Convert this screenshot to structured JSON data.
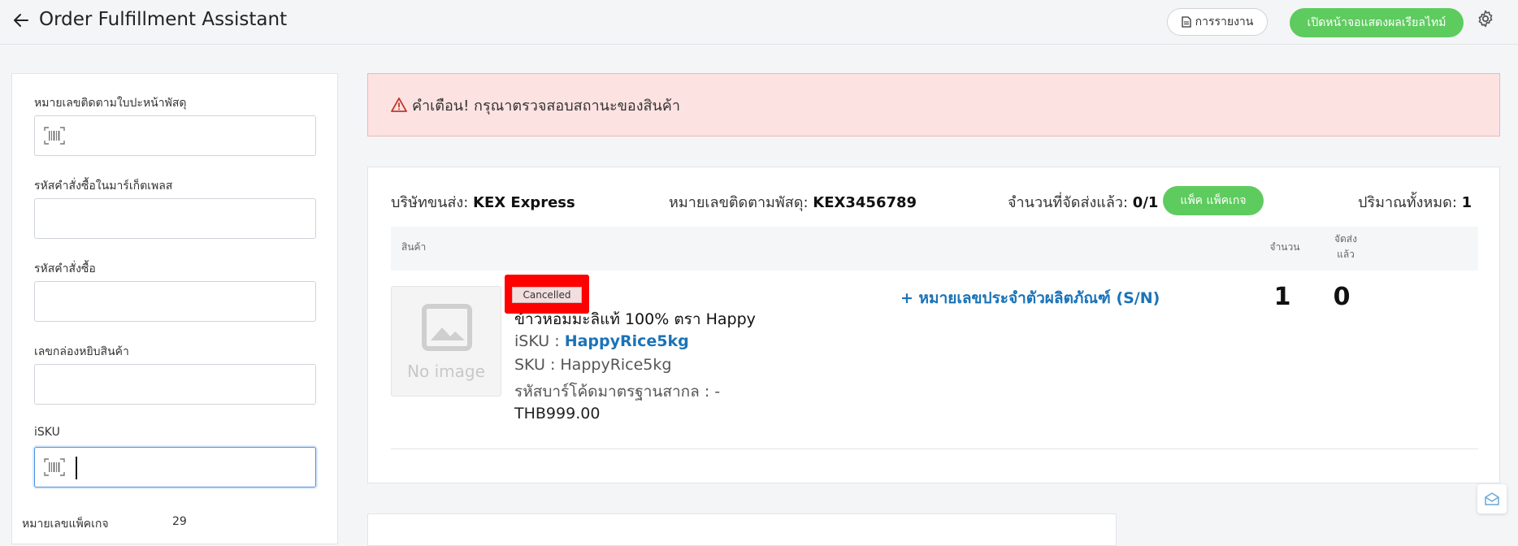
{
  "header": {
    "title": "Order Fulfillment Assistant",
    "report_label": "การรายงาน",
    "open_display_label": "เปิดหน้าจอแสดงผลเรียลไทม์"
  },
  "form": {
    "tracking_label": "หมายเลขติดตามใบปะหน้าพัสดุ",
    "marketplace_order_label": "รหัสคำสั่งซื้อในมาร์เก็ตเพลส",
    "order_id_label": "รหัสคำสั่งซื้อ",
    "pick_box_label": "เลขกล่องหยิบสินค้า",
    "isku_label": "iSKU",
    "package_no_label": "หมายเลขแพ็คเกจ",
    "package_no_value": "29"
  },
  "alert": {
    "text": "คำเตือน! กรุณาตรวจสอบสถานะของสินค้า"
  },
  "shipment": {
    "carrier_label": "บริษัทขนส่ง:",
    "carrier_value": "KEX Express",
    "tracking_label": "หมายเลขติดตามพัสดุ:",
    "tracking_value": "KEX3456789",
    "shipped_label": "จำนวนที่จัดส่งแล้ว:",
    "shipped_value": "0/1",
    "pack_button": "แพ็ค แพ็คเกจ",
    "total_label": "ปริมาณทั้งหมด:",
    "total_value": "1"
  },
  "table": {
    "col_product": "สินค้า",
    "col_qty": "จำนวน",
    "col_shipped_line1": "จัดส่ง",
    "col_shipped_line2": "แล้ว"
  },
  "product": {
    "no_image_text": "No image",
    "status": "Cancelled",
    "name": "ข้าวหอมมะลิแท้ 100% ตรา Happy",
    "isku_label": "iSKU :",
    "isku_value": "HappyRice5kg",
    "sku_line": "SKU : HappyRice5kg",
    "barcode_line": "รหัสบาร์โค้ดมาตรฐานสากล : -",
    "price": "THB999.00",
    "sn_link": "+ หมายเลขประจำตัวผลิตภัณฑ์ (S/N)",
    "qty": "1",
    "shipped": "0"
  },
  "colors": {
    "accent_green": "#5ecb5e",
    "link_blue": "#1a73b8",
    "alert_bg": "#fde2e2",
    "highlight_red": "#ff0000"
  }
}
